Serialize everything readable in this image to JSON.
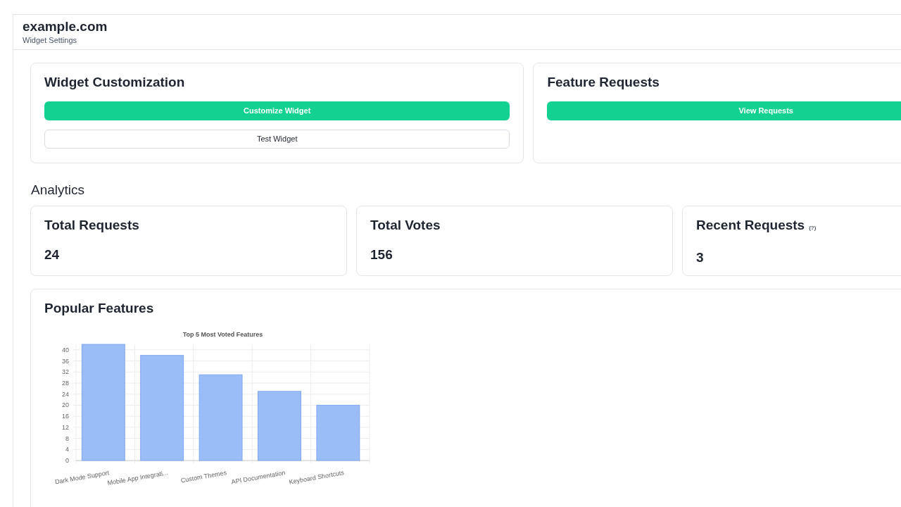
{
  "header": {
    "site": "example.com",
    "subtitle": "Widget Settings"
  },
  "panels": [
    {
      "title": "Widget Customization",
      "buttons": [
        {
          "label": "Customize Widget",
          "kind": "primary"
        },
        {
          "label": "Test Widget",
          "kind": "outline"
        }
      ]
    },
    {
      "title": "Feature Requests",
      "buttons": [
        {
          "label": "View Requests",
          "kind": "primary"
        }
      ]
    }
  ],
  "analytics": {
    "heading": "Analytics",
    "stats": [
      {
        "label": "Total Requests",
        "value": "24"
      },
      {
        "label": "Total Votes",
        "value": "156"
      },
      {
        "label": "Recent Requests",
        "hint": "(?)",
        "value": "3"
      }
    ]
  },
  "popular": {
    "title": "Popular Features",
    "chart_data": {
      "type": "bar",
      "title": "Top 5 Most Voted Features",
      "categories": [
        "Dark Mode Support",
        "Mobile App Integrati...",
        "Custom Themes",
        "API Documentation",
        "Keyboard Shortcuts"
      ],
      "series": [
        {
          "color": "#9bbdf7",
          "values": [
            42,
            38,
            31,
            25,
            20
          ]
        }
      ],
      "ylim": [
        0,
        42
      ],
      "grid": true,
      "yticks": [
        0,
        4,
        8,
        12,
        16,
        20,
        24,
        28,
        32,
        36,
        40
      ]
    }
  }
}
